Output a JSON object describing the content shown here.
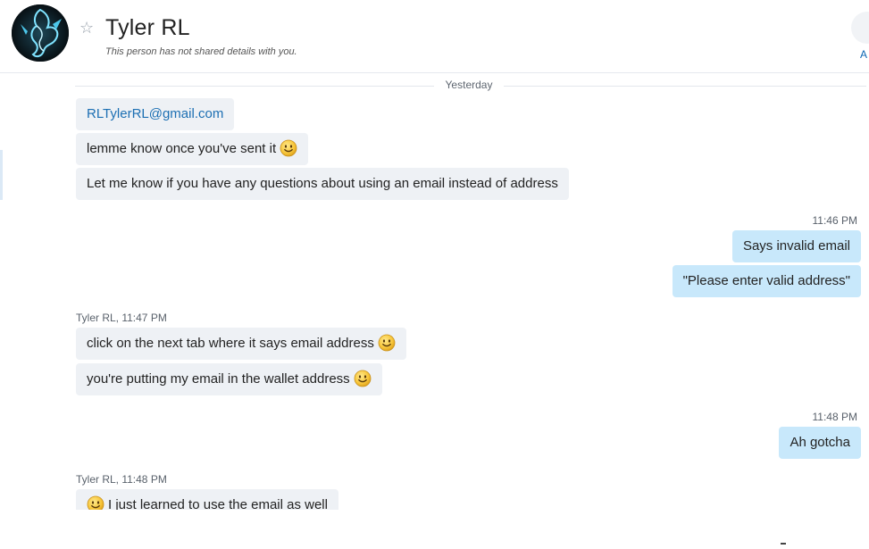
{
  "header": {
    "name": "Tyler RL",
    "subtitle": "This person has not shared details with you.",
    "right_fragment": "A"
  },
  "divider": {
    "label": "Yesterday"
  },
  "messages": {
    "m1": {
      "text": "RLTylerRL@gmail.com"
    },
    "m2": {
      "text": "lemme know once you've sent it"
    },
    "m3": {
      "text": "Let me know if you have any questions about using an email instead of address"
    },
    "t1": "11:46 PM",
    "m4": {
      "text": "Says invalid email"
    },
    "m5": {
      "text": "\"Please enter valid address\""
    },
    "s1": "Tyler RL,  11:47 PM",
    "m6": {
      "text": "click on the next tab where it says email address"
    },
    "m7": {
      "text": "you're putting my email in the wallet address"
    },
    "t2": "11:48 PM",
    "m8": {
      "text": "Ah gotcha"
    },
    "s2": "Tyler RL,  11:48 PM",
    "m9": {
      "text": "I just learned to use the email as well"
    }
  },
  "colors": {
    "incoming_bubble": "#eef1f5",
    "outgoing_bubble": "#c8e8fb",
    "link": "#1c6fb3"
  },
  "icons": {
    "star": "star-outline-icon",
    "emoji": "smiley-emoji-icon"
  }
}
